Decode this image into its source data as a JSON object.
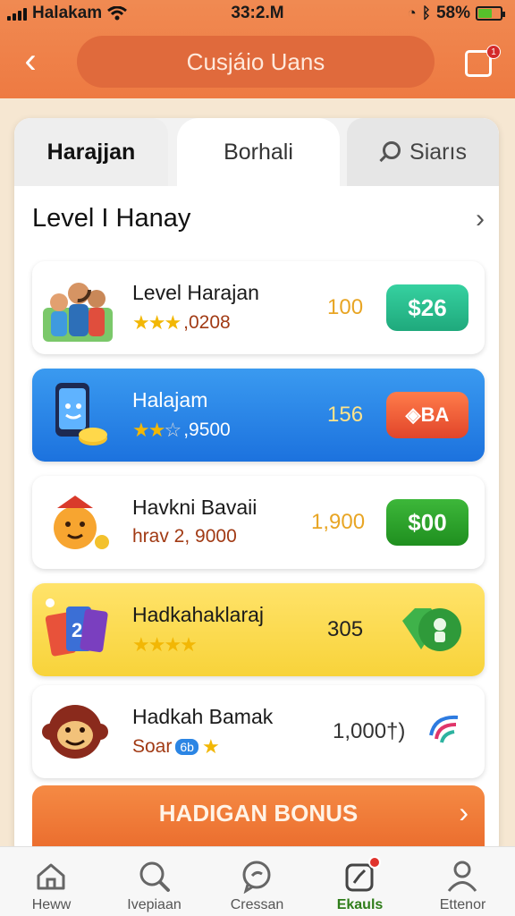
{
  "status_bar": {
    "carrier": "Halakam",
    "time": "33:2.M",
    "battery_text": "58%",
    "battery_level": 0.58
  },
  "header": {
    "title": "Cusjáio Uans",
    "notification_count": "1"
  },
  "tabs": [
    {
      "label": "Harajjan"
    },
    {
      "label": "Borhali"
    },
    {
      "label": "Siarıs"
    }
  ],
  "section": {
    "title": "Level I Hanay"
  },
  "items": [
    {
      "name": "Level Harajan",
      "stars": 3,
      "sub": ",0208",
      "value": "100",
      "action": "$26"
    },
    {
      "name": "Halajam",
      "stars": 2,
      "sub": ",9500",
      "value": "156",
      "action": "BA"
    },
    {
      "name": "Havkni Bavaii",
      "sub": "hrav 2, 9000",
      "value": "1,900",
      "action": "$00"
    },
    {
      "name": "Hadkahaklaraj",
      "stars": 4,
      "value": "305"
    },
    {
      "name": "Hadkah Bamak",
      "sub": "Soar",
      "badge": "6b",
      "value": "1,000†)"
    }
  ],
  "bonus": {
    "label": "HADIGAN BONUS"
  },
  "bottom_nav": [
    {
      "label": "Heww"
    },
    {
      "label": "Ivepiaan"
    },
    {
      "label": "Cressan"
    },
    {
      "label": "Ekauls",
      "active": true
    },
    {
      "label": "Ettenor"
    }
  ],
  "colors": {
    "header": "#ee7a42",
    "accent_blue": "#1c72de",
    "accent_yellow": "#f8d33a",
    "action_teal": "#1fa97c",
    "action_green": "#1f8f1f",
    "action_red": "#e1452a"
  }
}
